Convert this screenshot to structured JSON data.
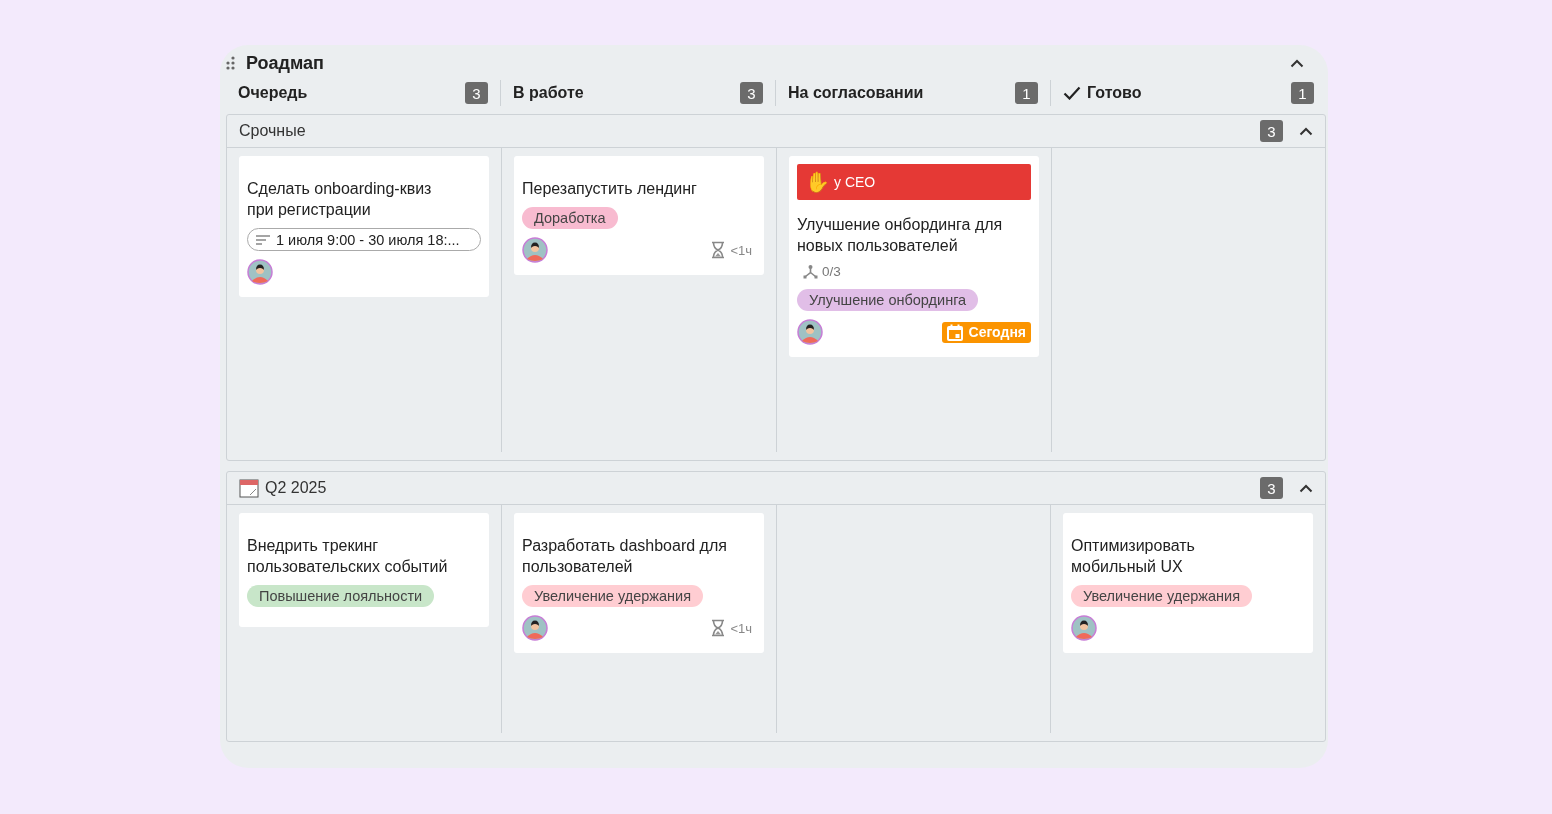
{
  "board": {
    "title": "Роадмап",
    "expanded": true
  },
  "columns": [
    {
      "title": "Очередь",
      "count": "3",
      "done": false
    },
    {
      "title": "В работе",
      "count": "3",
      "done": false
    },
    {
      "title": "На согласовании",
      "count": "1",
      "done": false
    },
    {
      "title": "Готово",
      "count": "1",
      "done": true
    }
  ],
  "lanes": [
    {
      "title": "Срочные",
      "kind": "plain",
      "count": "3",
      "expanded": true,
      "cells": [
        [
          {
            "title": "Сделать onboarding-квиз при регистрации",
            "date_range": "1 июля 9:00 - 30 июля 18:...",
            "avatar": true
          }
        ],
        [
          {
            "title": "Перезапустить лендинг",
            "tags": [
              {
                "label": "Доработка",
                "color": "#f8bbd0"
              }
            ],
            "avatar": true,
            "estimate": "<1ч"
          }
        ],
        [
          {
            "banner": {
              "icon": "✋",
              "text": "у CEO",
              "color": "#e53935"
            },
            "title": "Улучшение онбординга для новых пользователей",
            "subtasks": "0/3",
            "tags": [
              {
                "label": "Улучшение онбординга",
                "color": "#e1bee7"
              }
            ],
            "avatar": true,
            "due": "Сегодня"
          }
        ],
        []
      ]
    },
    {
      "title": "Q2 2025",
      "kind": "dated",
      "count": "3",
      "expanded": true,
      "cells": [
        [
          {
            "title": "Внедрить трекинг пользовательских событий",
            "tags": [
              {
                "label": "Повышение лояльности",
                "color": "#c8e6c9"
              }
            ]
          }
        ],
        [
          {
            "title": "Разработать dashboard для пользователей",
            "tags": [
              {
                "label": "Увеличение удержания",
                "color": "#ffcdd2"
              }
            ],
            "avatar": true,
            "estimate": "<1ч"
          }
        ],
        [],
        [
          {
            "title": "Оптимизировать мобильный UX",
            "tags": [
              {
                "label": "Увеличение удержания",
                "color": "#ffcdd2"
              }
            ],
            "avatar": true
          }
        ]
      ]
    }
  ]
}
